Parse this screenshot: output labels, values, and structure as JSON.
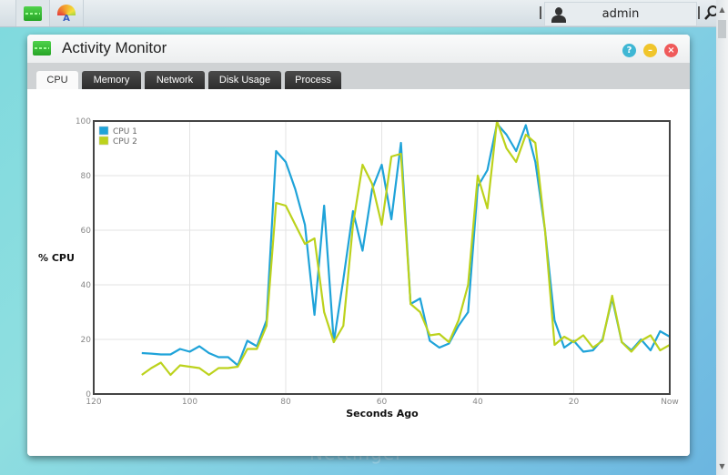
{
  "taskbar": {
    "apps": [
      {
        "name": "Activity Monitor",
        "icon": "activity-monitor-icon"
      },
      {
        "name": "App Central",
        "icon": "rainbow-a-icon",
        "letter": "A"
      }
    ],
    "user": {
      "label": "admin",
      "icon": "user-icon"
    },
    "search_icon": "search-icon"
  },
  "window": {
    "title": "Activity Monitor",
    "controls": {
      "help": "?",
      "minimize": "–",
      "close": "×"
    },
    "tabs": [
      {
        "label": "CPU",
        "active": true
      },
      {
        "label": "Memory",
        "active": false
      },
      {
        "label": "Network",
        "active": false
      },
      {
        "label": "Disk Usage",
        "active": false
      },
      {
        "label": "Process",
        "active": false
      }
    ]
  },
  "colors": {
    "cpu1": "#1fa3d9",
    "cpu2": "#bcd21c",
    "grid": "#e3e3e3",
    "axis": "#444444"
  },
  "chart_data": {
    "type": "line",
    "title": "",
    "xlabel": "Seconds Ago",
    "ylabel": "% CPU",
    "xlim": [
      120,
      0
    ],
    "ylim": [
      0,
      100
    ],
    "x_ticks": [
      120,
      100,
      80,
      60,
      40,
      20,
      0
    ],
    "x_tick_labels": [
      "120",
      "100",
      "80",
      "60",
      "40",
      "20",
      "Now"
    ],
    "y_ticks": [
      0,
      20,
      40,
      60,
      80,
      100
    ],
    "y_tick_labels": [
      "0",
      "20",
      "40",
      "60",
      "80",
      "100"
    ],
    "grid": true,
    "legend": "top-left",
    "x": [
      110,
      108,
      106,
      104,
      102,
      100,
      98,
      96,
      94,
      92,
      90,
      88,
      86,
      84,
      82,
      80,
      78,
      76,
      74,
      72,
      70,
      68,
      66,
      64,
      62,
      60,
      58,
      56,
      54,
      52,
      50,
      48,
      46,
      44,
      42,
      40,
      38,
      36,
      34,
      32,
      30,
      28,
      26,
      24,
      22,
      20,
      18,
      16,
      14,
      12,
      10,
      8,
      6,
      4,
      2,
      0
    ],
    "series": [
      {
        "name": "CPU 1",
        "color": "#1fa3d9",
        "values": [
          15,
          14.8,
          14.5,
          14.5,
          16.5,
          15.5,
          17.5,
          15,
          13.5,
          13.5,
          10.5,
          19.5,
          17.5,
          27,
          89,
          85,
          75,
          62,
          29,
          69,
          19,
          42,
          67,
          52.5,
          75,
          84,
          64,
          92,
          33,
          35,
          19.5,
          17,
          18.5,
          25,
          30,
          76,
          82,
          99,
          95,
          89,
          98.5,
          85,
          60,
          27,
          17,
          19.5,
          15.5,
          16,
          20,
          35,
          19,
          16,
          20,
          16,
          23,
          21
        ]
      },
      {
        "name": "CPU 2",
        "color": "#bcd21c",
        "values": [
          7,
          9.5,
          11.5,
          7,
          10.5,
          10,
          9.5,
          7,
          9.5,
          9.5,
          10,
          16.5,
          16.5,
          25,
          70,
          69,
          62,
          55,
          57,
          30,
          19,
          25,
          62,
          84,
          77,
          62,
          87,
          88,
          33,
          30,
          21.5,
          22,
          19,
          27,
          40,
          80,
          68,
          100,
          90,
          85,
          95,
          92,
          60,
          18,
          21,
          19,
          21.5,
          17,
          19.5,
          36,
          19,
          15.5,
          19.5,
          21.5,
          16,
          18
        ]
      }
    ]
  },
  "watermark": "Nettinger"
}
